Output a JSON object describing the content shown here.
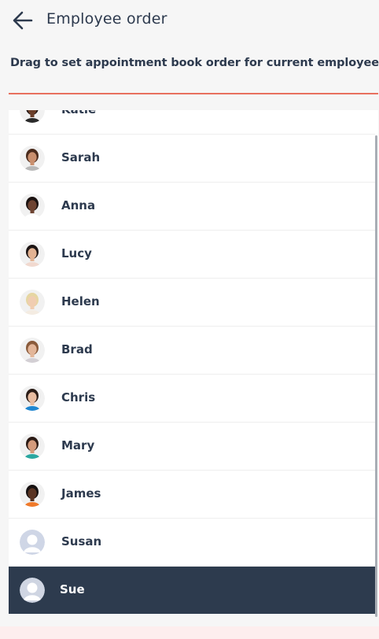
{
  "header": {
    "title": "Employee order",
    "back_icon": "arrow-left-icon"
  },
  "subtitle": "Drag to set appointment book order for current employee",
  "colors": {
    "text": "#2d3a4e",
    "accent_underline": "#e8705f",
    "selected_row": "#2d3b4e",
    "background": "#f6f6f6"
  },
  "employees": [
    {
      "name": "Katie",
      "avatar": "photo",
      "skin": "#6b3f2a",
      "hair": "#1e1412",
      "shirt": "#2a2a2a"
    },
    {
      "name": "Sarah",
      "avatar": "photo",
      "skin": "#c98f6e",
      "hair": "#4a2b1c",
      "shirt": "#b8b8b8"
    },
    {
      "name": "Anna",
      "avatar": "photo",
      "skin": "#6e4331",
      "hair": "#1b1210",
      "shirt": "#ffffff"
    },
    {
      "name": "Lucy",
      "avatar": "photo",
      "skin": "#e3b393",
      "hair": "#1c1413",
      "shirt": "#f1d9cf"
    },
    {
      "name": "Helen",
      "avatar": "photo",
      "skin": "#f0cdb1",
      "hair": "#e6d6a2",
      "shirt": "#f4ece2"
    },
    {
      "name": "Brad",
      "avatar": "photo",
      "skin": "#e3b699",
      "hair": "#8a5b3b",
      "shirt": "#d3cfd4"
    },
    {
      "name": "Chris",
      "avatar": "photo",
      "skin": "#e8bca0",
      "hair": "#2a1c16",
      "shirt": "#1f86d0"
    },
    {
      "name": "Mary",
      "avatar": "photo",
      "skin": "#d49b7c",
      "hair": "#2b1a14",
      "shirt": "#2ba7a0"
    },
    {
      "name": "James",
      "avatar": "photo",
      "skin": "#5a3423",
      "hair": "#151010",
      "shirt": "#f07a2a"
    },
    {
      "name": "Susan",
      "avatar": "placeholder"
    },
    {
      "name": "Sue",
      "avatar": "placeholder",
      "selected": true
    }
  ]
}
